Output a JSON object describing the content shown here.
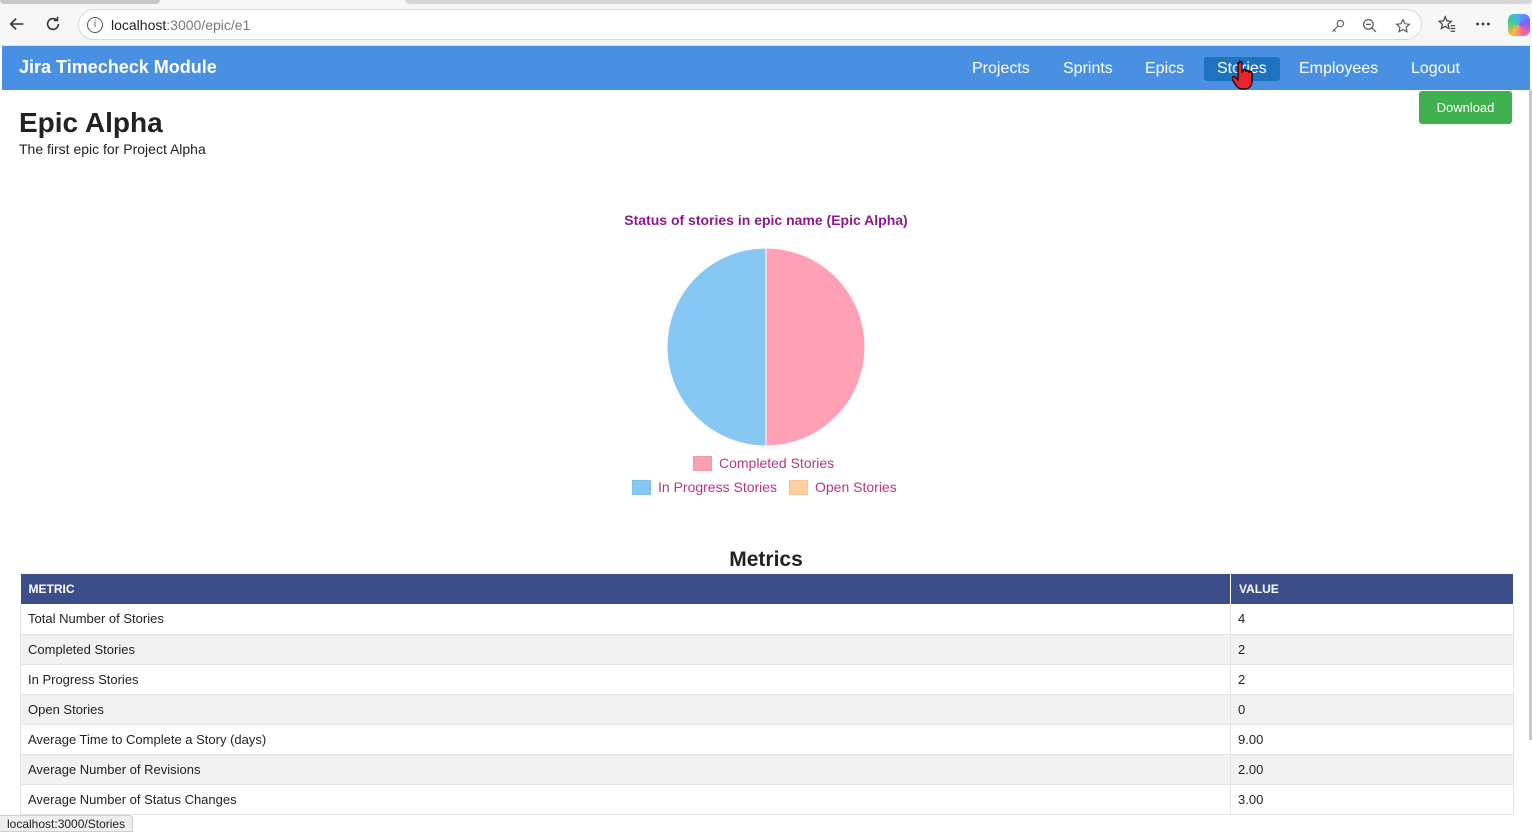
{
  "browser": {
    "url_host": "localhost",
    "url_rest": ":3000/epic/e1",
    "status_url": "localhost:3000/Stories"
  },
  "navbar": {
    "brand": "Jira Timecheck Module",
    "links": [
      "Projects",
      "Sprints",
      "Epics",
      "Stories",
      "Employees",
      "Logout"
    ],
    "active": "Stories",
    "color": "#4a90e2"
  },
  "page": {
    "title": "Epic Alpha",
    "subtitle": "The first epic for Project Alpha",
    "download_label": "Download"
  },
  "chart_data": {
    "type": "pie",
    "title": "Status of stories in epic name (Epic Alpha)",
    "categories": [
      "Completed Stories",
      "In Progress Stories",
      "Open Stories"
    ],
    "values": [
      2,
      2,
      0
    ],
    "colors": [
      "#ffa1b5",
      "#86c7f3",
      "#ffcf9f"
    ],
    "legend": "bottom"
  },
  "metrics": {
    "title": "Metrics",
    "headers": [
      "METRIC",
      "VALUE"
    ],
    "rows": [
      [
        "Total Number of Stories",
        "4"
      ],
      [
        "Completed Stories",
        "2"
      ],
      [
        "In Progress Stories",
        "2"
      ],
      [
        "Open Stories",
        "0"
      ],
      [
        "Average Time to Complete a Story (days)",
        "9.00"
      ],
      [
        "Average Number of Revisions",
        "2.00"
      ],
      [
        "Average Number of Status Changes",
        "3.00"
      ]
    ]
  }
}
